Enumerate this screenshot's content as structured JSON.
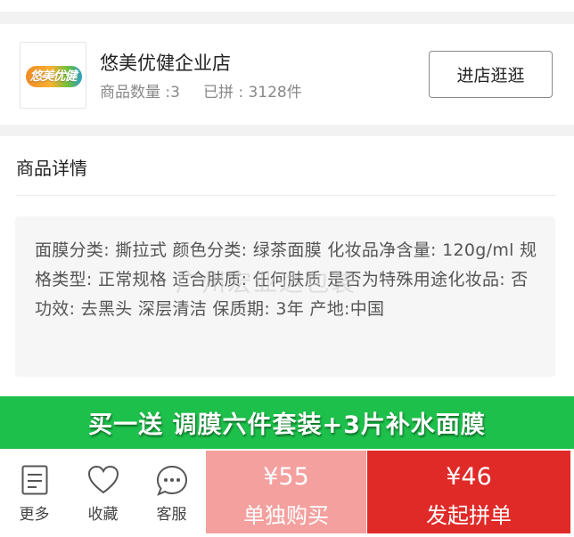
{
  "shop": {
    "logo_text": "悠美优健",
    "name": "悠美优健企业店",
    "product_count": "商品数量 :3",
    "sold_count": "已拼 : 3128件",
    "enter_button": "进店逛逛"
  },
  "detail": {
    "title": "商品详情",
    "text": "面膜分类: 撕拉式 颜色分类: 绿茶面膜 化妆品净含量: 120g/ml 规格类型: 正常规格 适合肤质: 任何肤质 是否为特殊用途化妆品: 否 功效: 去黑头 深层清洁 保质期: 3年 产地:中国",
    "watermark": "广州宏业达包装"
  },
  "promo": {
    "text": "买一送 调膜六件套装+3片补水面膜",
    "color": "#1dc04a"
  },
  "bottom_bar": {
    "more_label": "更多",
    "more_icon": "list-icon",
    "favorite_label": "收藏",
    "favorite_icon": "heart-icon",
    "service_label": "客服",
    "service_icon": "chat-bubble-icon",
    "solo_price": "¥55",
    "solo_label": "单独购买",
    "group_price": "¥46",
    "group_label": "发起拼单",
    "solo_color": "#f3a09e",
    "group_color": "#e02a28"
  }
}
